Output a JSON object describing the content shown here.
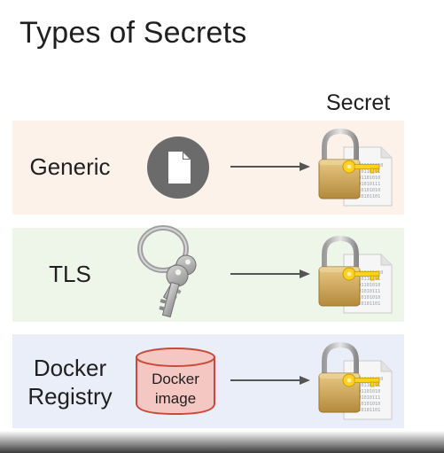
{
  "title": "Types of Secrets",
  "secret_header": "Secret",
  "rows": [
    {
      "label": "Generic",
      "source_icon": "document-icon",
      "background": "#fcf2ea"
    },
    {
      "label": "TLS",
      "source_icon": "keys-icon",
      "background": "#eef5e9"
    },
    {
      "label_line1": "Docker",
      "label_line2": "Registry",
      "source_icon": "database-icon",
      "source_line1": "Docker",
      "source_line2": "image",
      "background": "#e9eef8"
    }
  ],
  "secret_icon": "lock-document-icon",
  "colors": {
    "doc_circle": "#6b6b6b",
    "db_fill": "#f4c7c3",
    "db_stroke": "#c94a3c",
    "arrow": "#555555",
    "lock_body": "#d9b36a",
    "key": "#ffd21f"
  }
}
